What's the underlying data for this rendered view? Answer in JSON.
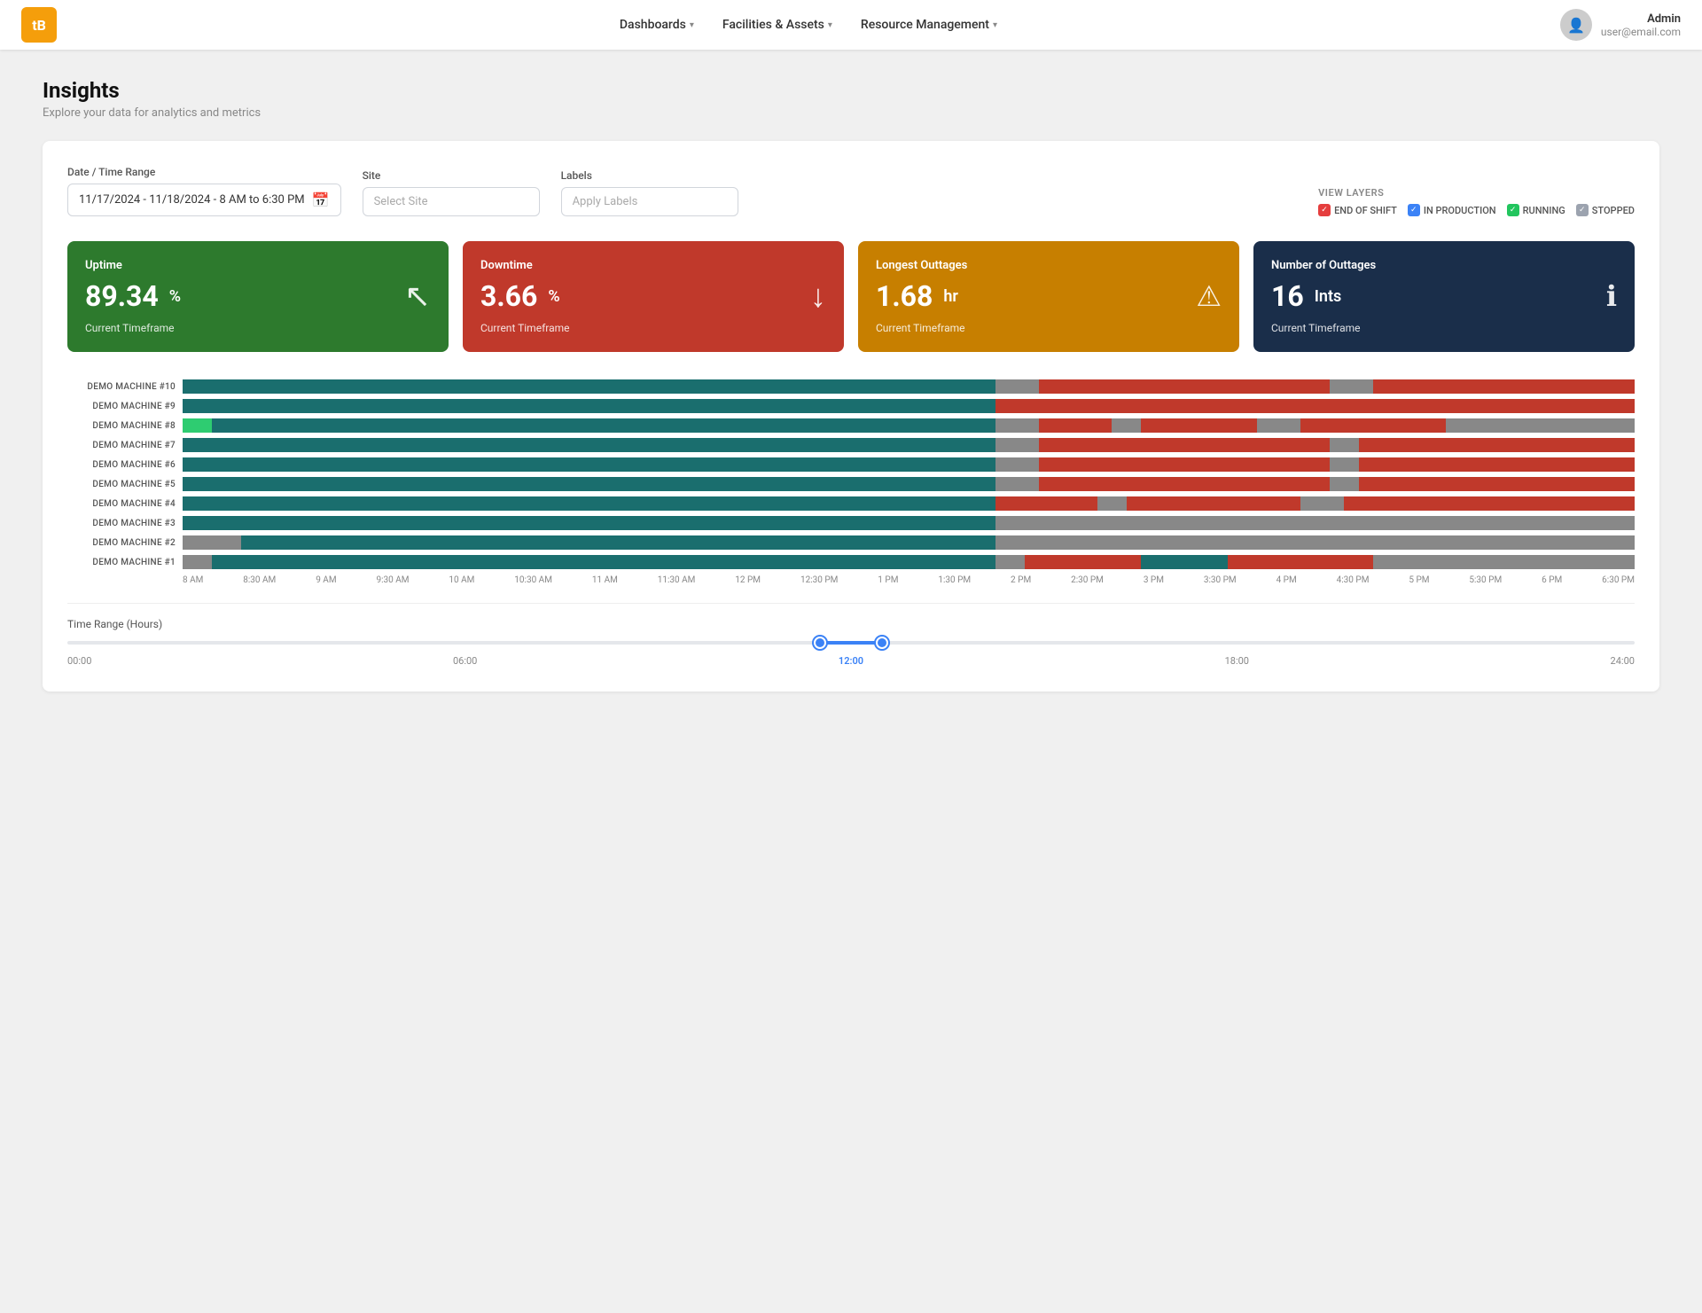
{
  "app": {
    "logo": "tB",
    "nav": [
      {
        "id": "dashboards",
        "label": "Dashboards",
        "hasDropdown": true
      },
      {
        "id": "facilities",
        "label": "Facilities & Assets",
        "hasDropdown": true
      },
      {
        "id": "resource",
        "label": "Resource Management",
        "hasDropdown": true
      }
    ],
    "user": {
      "name": "Admin",
      "email": "user@email.com"
    }
  },
  "page": {
    "title": "Insights",
    "subtitle": "Explore your data for analytics and metrics"
  },
  "filters": {
    "dateLabel": "Date / Time Range",
    "dateValue": "11/17/2024 - 11/18/2024 -  8 AM to 6:30 PM",
    "siteLabel": "Site",
    "sitePlaceholder": "Select Site",
    "labelsLabel": "Labels",
    "labelsPlaceholder": "Apply Labels",
    "viewLayersLabel": "VIEW LAYERS",
    "layers": [
      {
        "id": "end-of-shift",
        "label": "END OF SHIFT",
        "color": "red",
        "checked": true
      },
      {
        "id": "in-production",
        "label": "IN PRODUCTION",
        "color": "blue",
        "checked": true
      },
      {
        "id": "running",
        "label": "RUNNING",
        "color": "green",
        "checked": true
      },
      {
        "id": "stopped",
        "label": "STOPPED",
        "color": "gray",
        "checked": true
      }
    ]
  },
  "metrics": [
    {
      "id": "uptime",
      "title": "Uptime",
      "value": "89.34",
      "unit": "%",
      "footer": "Current Timeframe",
      "icon": "↖",
      "theme": "green"
    },
    {
      "id": "downtime",
      "title": "Downtime",
      "value": "3.66",
      "unit": "%",
      "footer": "Current Timeframe",
      "icon": "↓",
      "theme": "red"
    },
    {
      "id": "longest-outages",
      "title": "Longest Outtages",
      "value": "1.68",
      "unit": "hr",
      "footer": "Current Timeframe",
      "icon": "⚠",
      "theme": "amber"
    },
    {
      "id": "number-of-outages",
      "title": "Number of Outtages",
      "value": "16",
      "unit": "Ints",
      "footer": "Current Timeframe",
      "icon": "ℹ",
      "theme": "navy"
    }
  ],
  "gantt": {
    "machines": [
      {
        "label": "DEMO MACHINE #10",
        "id": "machine-10"
      },
      {
        "label": "DEMO MACHINE #9",
        "id": "machine-9"
      },
      {
        "label": "DEMO MACHINE #8",
        "id": "machine-8"
      },
      {
        "label": "DEMO MACHINE #7",
        "id": "machine-7"
      },
      {
        "label": "DEMO MACHINE #6",
        "id": "machine-6"
      },
      {
        "label": "DEMO MACHINE #5",
        "id": "machine-5"
      },
      {
        "label": "DEMO MACHINE #4",
        "id": "machine-4"
      },
      {
        "label": "DEMO MACHINE #3",
        "id": "machine-3"
      },
      {
        "label": "DEMO MACHINE #2",
        "id": "machine-2"
      },
      {
        "label": "DEMO MACHINE #1",
        "id": "machine-1"
      }
    ],
    "timeLabels": [
      "8 AM",
      "8:30 AM",
      "9 AM",
      "9:30 AM",
      "10 AM",
      "10:30 AM",
      "11 AM",
      "11:30 AM",
      "12 PM",
      "12:30 PM",
      "1 PM",
      "1:30 PM",
      "2 PM",
      "2:30 PM",
      "3 PM",
      "3:30 PM",
      "4 PM",
      "4:30 PM",
      "5 PM",
      "5:30 PM",
      "6 PM",
      "6:30 PM"
    ]
  },
  "slider": {
    "title": "Time Range (Hours)",
    "leftValue": "00:00",
    "rightValue": "24:00",
    "midLeft": "06:00",
    "midRight": "18:00",
    "currentLabel": "12:00"
  }
}
